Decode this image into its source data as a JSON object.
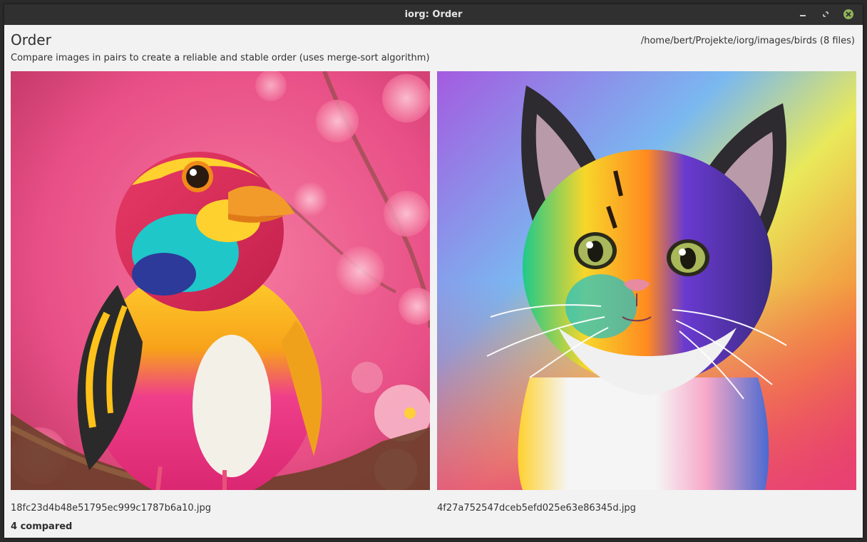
{
  "window": {
    "title": "iorg: Order",
    "buttons": {
      "minimize": "minimize-icon",
      "maximize": "maximize-icon",
      "close": "close-icon"
    },
    "close_color": "#8fb35a"
  },
  "header": {
    "title": "Order",
    "subtitle": "Compare images in pairs to create a reliable and stable order (uses merge-sort algorithm)",
    "folder": "/home/bert/Projekte/iorg/images/birds (8 files)"
  },
  "comparison": {
    "left": {
      "filename": "18fc23d4b48e51795ec999c1787b6a10.jpg",
      "image": "colorful-bird-on-cherry-blossom-branch"
    },
    "right": {
      "filename": "4f27a752547dceb5efd025e63e86345d.jpg",
      "image": "rainbow-colored-kitten"
    }
  },
  "status": {
    "compared": "4 compared"
  }
}
